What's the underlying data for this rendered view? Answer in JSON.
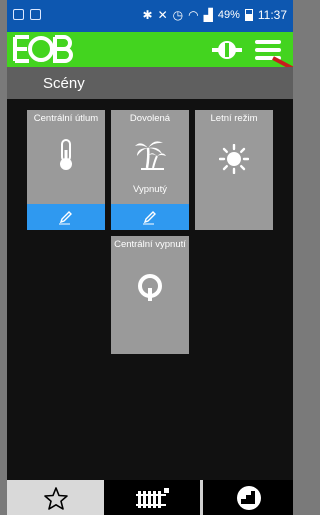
{
  "status": {
    "battery": "49%",
    "time": "11:37"
  },
  "header": {
    "title": "Scény"
  },
  "scenes": [
    {
      "label": "Centrální útlum",
      "icon": "thermometer-icon",
      "status": ""
    },
    {
      "label": "Dovolená",
      "icon": "palm-tree-icon",
      "status": "Vypnutý"
    },
    {
      "label": "Letní režim",
      "icon": "sun-icon",
      "status": ""
    },
    {
      "label": "Centrální vypnutí",
      "icon": "power-icon",
      "status": ""
    }
  ],
  "bottom_nav": [
    {
      "icon": "star-icon",
      "active": true
    },
    {
      "icon": "radiator-icon",
      "active": false
    },
    {
      "icon": "gauge-icon",
      "active": false
    }
  ],
  "colors": {
    "appbar": "#43d41f",
    "statusbar": "#0d57b0",
    "edit_bar": "#2f99f0",
    "tile": "#9a9a9a"
  }
}
